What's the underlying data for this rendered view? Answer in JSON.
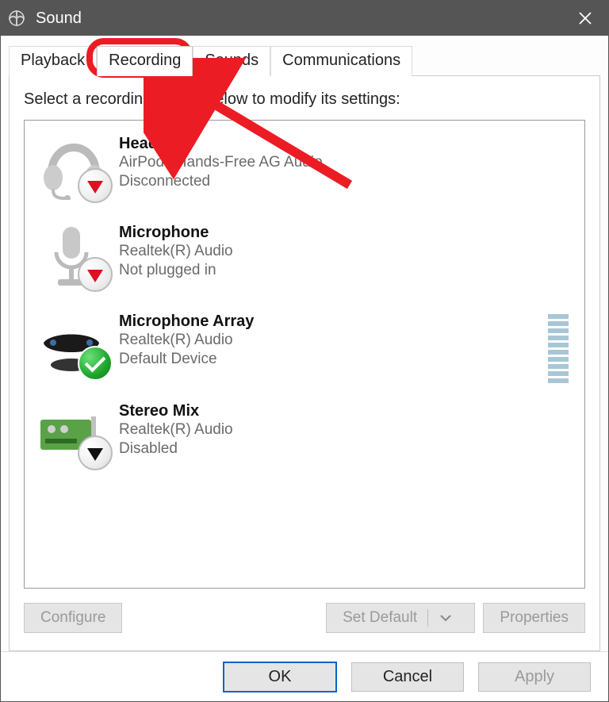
{
  "window": {
    "title": "Sound"
  },
  "tabs": {
    "playback": "Playback",
    "recording": "Recording",
    "sounds": "Sounds",
    "communications": "Communications",
    "active": "recording"
  },
  "instruction": "Select a recording device below to modify its settings:",
  "devices": [
    {
      "name": "Headset",
      "provider": "AirPods Hands-Free AG Audio",
      "status": "Disconnected",
      "overlay": "red-down",
      "meter": false
    },
    {
      "name": "Microphone",
      "provider": "Realtek(R) Audio",
      "status": "Not plugged in",
      "overlay": "red-down",
      "meter": false
    },
    {
      "name": "Microphone Array",
      "provider": "Realtek(R) Audio",
      "status": "Default Device",
      "overlay": "check",
      "meter": true
    },
    {
      "name": "Stereo Mix",
      "provider": "Realtek(R) Audio",
      "status": "Disabled",
      "overlay": "black-down",
      "meter": false
    }
  ],
  "lower": {
    "configure": "Configure",
    "set_default": "Set Default",
    "properties": "Properties"
  },
  "dialog": {
    "ok": "OK",
    "cancel": "Cancel",
    "apply": "Apply"
  },
  "annotation": {
    "highlight_tab": "recording"
  },
  "icons": {
    "close": "close-icon",
    "app": "sound-app-icon",
    "headset": "headset-icon",
    "microphone": "microphone-icon",
    "mic_array": "microphone-array-icon",
    "stereo_mix": "sound-card-icon",
    "dropdown": "chevron-down-icon",
    "status_down": "unavailable-overlay-icon",
    "status_check": "default-overlay-icon"
  }
}
